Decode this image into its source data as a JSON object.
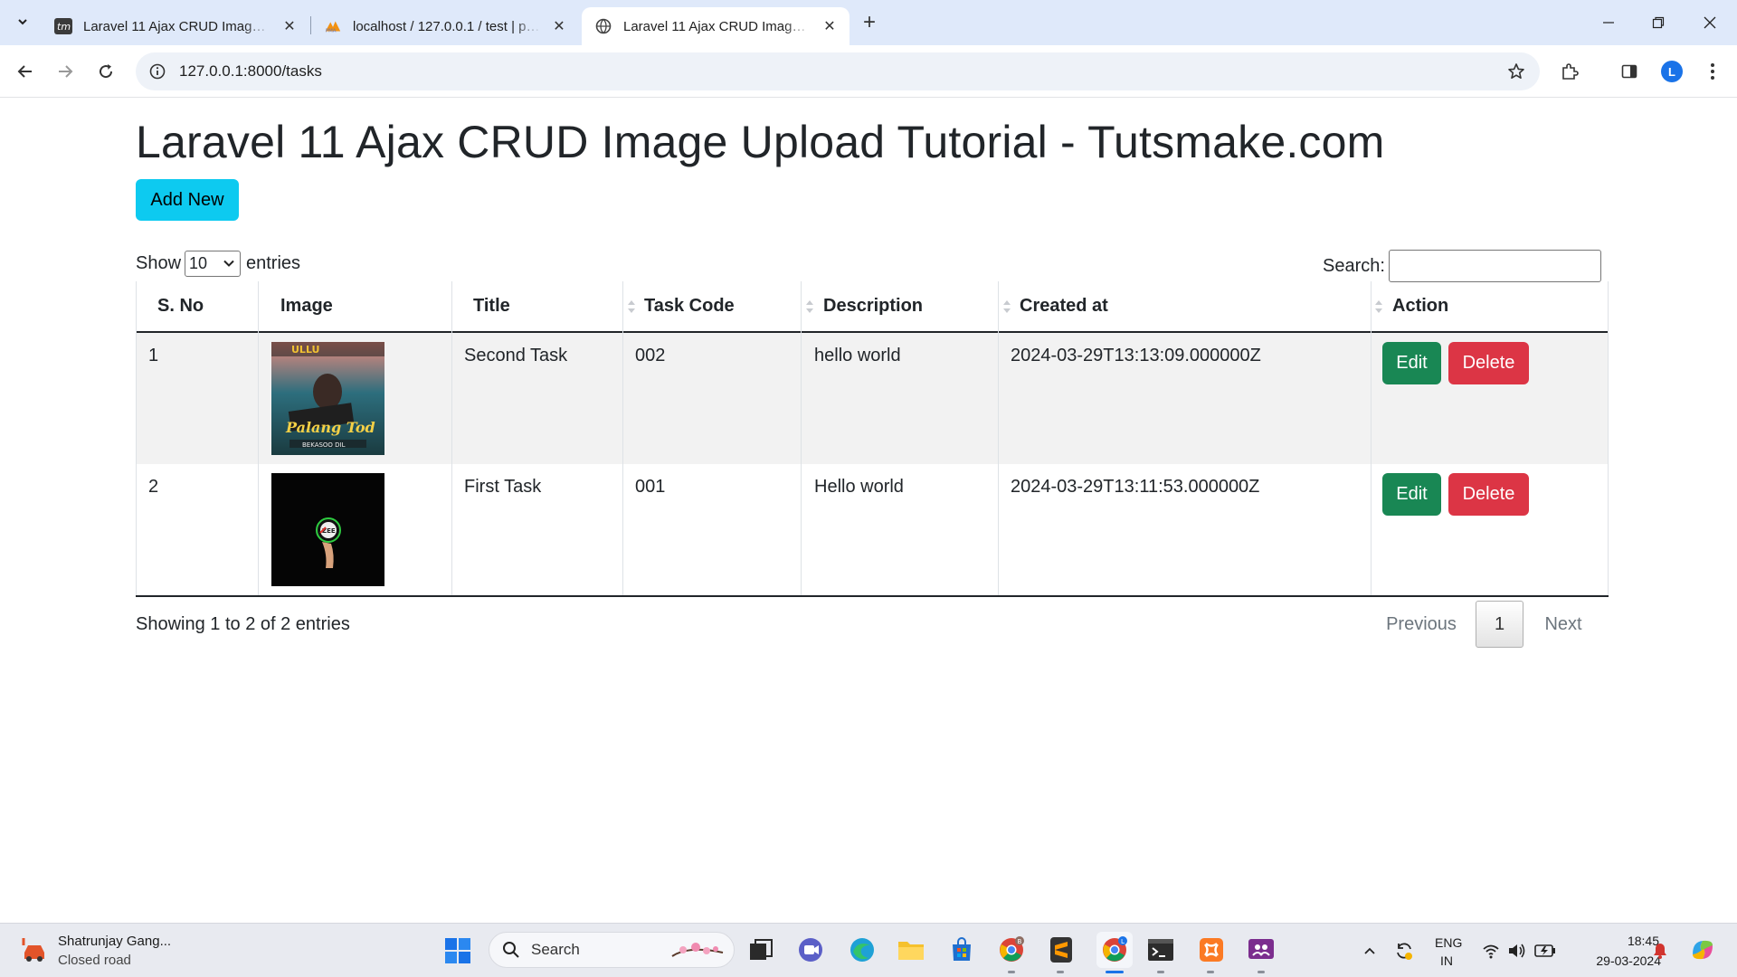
{
  "browser": {
    "tabs": [
      {
        "title": "Laravel 11 Ajax CRUD Image Up",
        "favicon": "tm-favicon",
        "active": false
      },
      {
        "title": "localhost / 127.0.0.1 / test | php",
        "favicon": "phpmyadmin-favicon",
        "active": false
      },
      {
        "title": "Laravel 11 Ajax CRUD Image Up",
        "favicon": "globe-favicon",
        "active": true
      }
    ],
    "url": "127.0.0.1:8000/tasks",
    "profile_initial": "L"
  },
  "page": {
    "title": "Laravel 11 Ajax CRUD Image Upload Tutorial - Tutsmake.com",
    "add_button": "Add New",
    "length": {
      "show": "Show",
      "value": "10",
      "entries": "entries"
    },
    "search": {
      "label": "Search:",
      "value": ""
    },
    "columns": [
      "S. No",
      "Image",
      "Title",
      "Task Code",
      "Description",
      "Created at",
      "Action"
    ],
    "rows": [
      {
        "sno": "1",
        "image": "poster-thumbnail",
        "title": "Second Task",
        "code": "002",
        "description": "hello world",
        "created_at": "2024-03-29T13:13:09.000000Z",
        "edit": "Edit",
        "delete": "Delete"
      },
      {
        "sno": "2",
        "image": "dark-thumbnail",
        "title": "First Task",
        "code": "001",
        "description": "Hello world",
        "created_at": "2024-03-29T13:11:53.000000Z",
        "edit": "Edit",
        "delete": "Delete"
      }
    ],
    "info": "Showing 1 to 2 of 2 entries",
    "pagination": {
      "previous": "Previous",
      "current": "1",
      "next": "Next"
    }
  },
  "colors": {
    "add": "#0dcaf0",
    "edit": "#198754",
    "delete": "#dc3545"
  },
  "taskbar": {
    "weather": {
      "line1": "Shatrunjay Gang...",
      "line2": "Closed road"
    },
    "search_placeholder": "Search",
    "language": {
      "line1": "ENG",
      "line2": "IN"
    },
    "clock": {
      "time": "18:45",
      "date": "29-03-2024"
    }
  }
}
